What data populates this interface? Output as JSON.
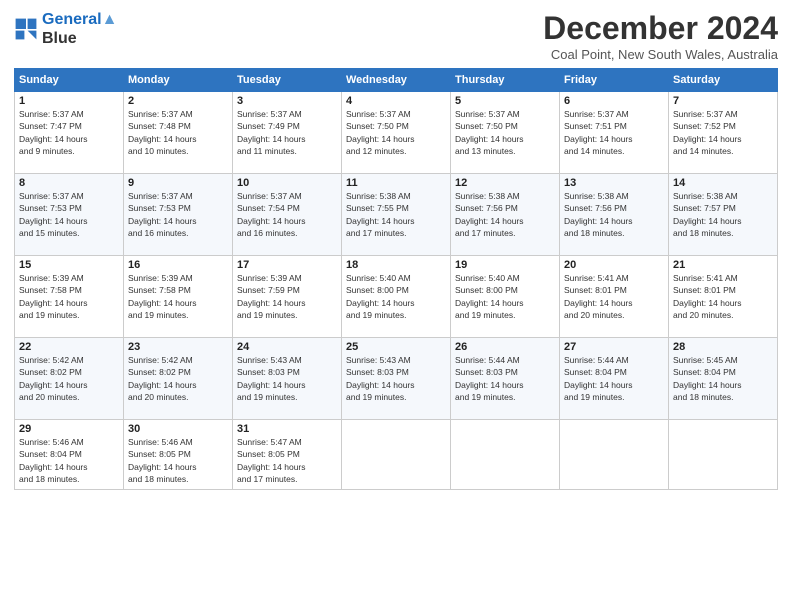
{
  "header": {
    "logo_line1": "General",
    "logo_line2": "Blue",
    "month_title": "December 2024",
    "subtitle": "Coal Point, New South Wales, Australia"
  },
  "weekdays": [
    "Sunday",
    "Monday",
    "Tuesday",
    "Wednesday",
    "Thursday",
    "Friday",
    "Saturday"
  ],
  "weeks": [
    [
      {
        "day": "1",
        "info": "Sunrise: 5:37 AM\nSunset: 7:47 PM\nDaylight: 14 hours\nand 9 minutes."
      },
      {
        "day": "2",
        "info": "Sunrise: 5:37 AM\nSunset: 7:48 PM\nDaylight: 14 hours\nand 10 minutes."
      },
      {
        "day": "3",
        "info": "Sunrise: 5:37 AM\nSunset: 7:49 PM\nDaylight: 14 hours\nand 11 minutes."
      },
      {
        "day": "4",
        "info": "Sunrise: 5:37 AM\nSunset: 7:50 PM\nDaylight: 14 hours\nand 12 minutes."
      },
      {
        "day": "5",
        "info": "Sunrise: 5:37 AM\nSunset: 7:50 PM\nDaylight: 14 hours\nand 13 minutes."
      },
      {
        "day": "6",
        "info": "Sunrise: 5:37 AM\nSunset: 7:51 PM\nDaylight: 14 hours\nand 14 minutes."
      },
      {
        "day": "7",
        "info": "Sunrise: 5:37 AM\nSunset: 7:52 PM\nDaylight: 14 hours\nand 14 minutes."
      }
    ],
    [
      {
        "day": "8",
        "info": "Sunrise: 5:37 AM\nSunset: 7:53 PM\nDaylight: 14 hours\nand 15 minutes."
      },
      {
        "day": "9",
        "info": "Sunrise: 5:37 AM\nSunset: 7:53 PM\nDaylight: 14 hours\nand 16 minutes."
      },
      {
        "day": "10",
        "info": "Sunrise: 5:37 AM\nSunset: 7:54 PM\nDaylight: 14 hours\nand 16 minutes."
      },
      {
        "day": "11",
        "info": "Sunrise: 5:38 AM\nSunset: 7:55 PM\nDaylight: 14 hours\nand 17 minutes."
      },
      {
        "day": "12",
        "info": "Sunrise: 5:38 AM\nSunset: 7:56 PM\nDaylight: 14 hours\nand 17 minutes."
      },
      {
        "day": "13",
        "info": "Sunrise: 5:38 AM\nSunset: 7:56 PM\nDaylight: 14 hours\nand 18 minutes."
      },
      {
        "day": "14",
        "info": "Sunrise: 5:38 AM\nSunset: 7:57 PM\nDaylight: 14 hours\nand 18 minutes."
      }
    ],
    [
      {
        "day": "15",
        "info": "Sunrise: 5:39 AM\nSunset: 7:58 PM\nDaylight: 14 hours\nand 19 minutes."
      },
      {
        "day": "16",
        "info": "Sunrise: 5:39 AM\nSunset: 7:58 PM\nDaylight: 14 hours\nand 19 minutes."
      },
      {
        "day": "17",
        "info": "Sunrise: 5:39 AM\nSunset: 7:59 PM\nDaylight: 14 hours\nand 19 minutes."
      },
      {
        "day": "18",
        "info": "Sunrise: 5:40 AM\nSunset: 8:00 PM\nDaylight: 14 hours\nand 19 minutes."
      },
      {
        "day": "19",
        "info": "Sunrise: 5:40 AM\nSunset: 8:00 PM\nDaylight: 14 hours\nand 19 minutes."
      },
      {
        "day": "20",
        "info": "Sunrise: 5:41 AM\nSunset: 8:01 PM\nDaylight: 14 hours\nand 20 minutes."
      },
      {
        "day": "21",
        "info": "Sunrise: 5:41 AM\nSunset: 8:01 PM\nDaylight: 14 hours\nand 20 minutes."
      }
    ],
    [
      {
        "day": "22",
        "info": "Sunrise: 5:42 AM\nSunset: 8:02 PM\nDaylight: 14 hours\nand 20 minutes."
      },
      {
        "day": "23",
        "info": "Sunrise: 5:42 AM\nSunset: 8:02 PM\nDaylight: 14 hours\nand 20 minutes."
      },
      {
        "day": "24",
        "info": "Sunrise: 5:43 AM\nSunset: 8:03 PM\nDaylight: 14 hours\nand 19 minutes."
      },
      {
        "day": "25",
        "info": "Sunrise: 5:43 AM\nSunset: 8:03 PM\nDaylight: 14 hours\nand 19 minutes."
      },
      {
        "day": "26",
        "info": "Sunrise: 5:44 AM\nSunset: 8:03 PM\nDaylight: 14 hours\nand 19 minutes."
      },
      {
        "day": "27",
        "info": "Sunrise: 5:44 AM\nSunset: 8:04 PM\nDaylight: 14 hours\nand 19 minutes."
      },
      {
        "day": "28",
        "info": "Sunrise: 5:45 AM\nSunset: 8:04 PM\nDaylight: 14 hours\nand 18 minutes."
      }
    ],
    [
      {
        "day": "29",
        "info": "Sunrise: 5:46 AM\nSunset: 8:04 PM\nDaylight: 14 hours\nand 18 minutes."
      },
      {
        "day": "30",
        "info": "Sunrise: 5:46 AM\nSunset: 8:05 PM\nDaylight: 14 hours\nand 18 minutes."
      },
      {
        "day": "31",
        "info": "Sunrise: 5:47 AM\nSunset: 8:05 PM\nDaylight: 14 hours\nand 17 minutes."
      },
      null,
      null,
      null,
      null
    ]
  ]
}
